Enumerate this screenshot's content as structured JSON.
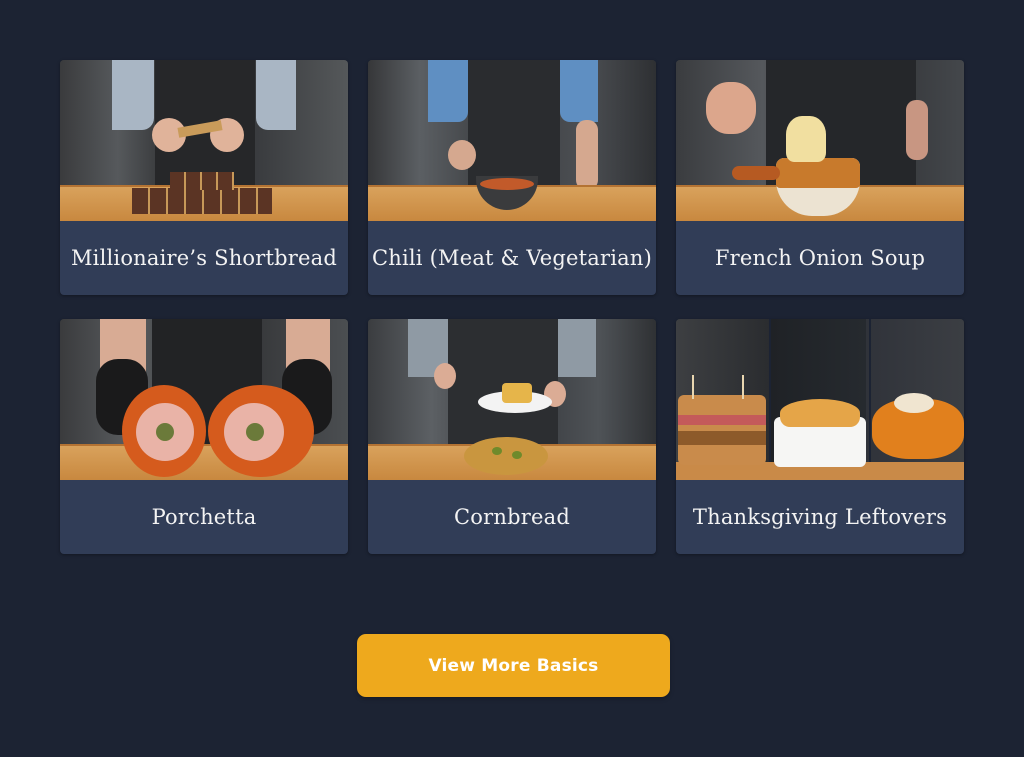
{
  "recipes": [
    {
      "title": "Millionaire’s Shortbread",
      "image": "shortbread-thumbnail"
    },
    {
      "title": "Chili (Meat & Vegetarian)",
      "image": "chili-thumbnail"
    },
    {
      "title": "French Onion Soup",
      "image": "french-onion-soup-thumbnail"
    },
    {
      "title": "Porchetta",
      "image": "porchetta-thumbnail"
    },
    {
      "title": "Cornbread",
      "image": "cornbread-thumbnail"
    },
    {
      "title": "Thanksgiving Leftovers",
      "image": "thanksgiving-leftovers-thumbnail"
    }
  ],
  "cta": {
    "label": "View More Basics"
  },
  "colors": {
    "background": "#1c2333",
    "card": "#313d57",
    "button": "#eea91d",
    "text": "#f3f3f3"
  }
}
